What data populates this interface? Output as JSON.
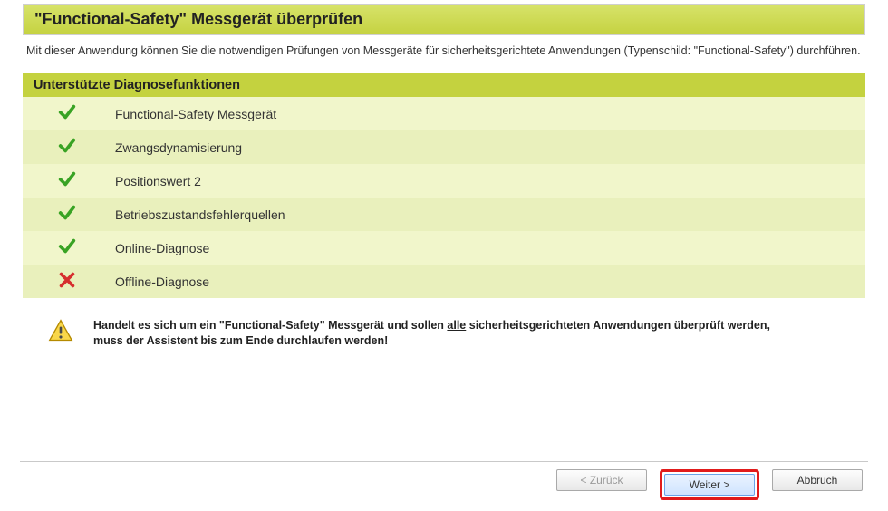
{
  "header": {
    "title": "\"Functional-Safety\" Messgerät überprüfen"
  },
  "intro": "Mit dieser Anwendung können Sie die notwendigen Prüfungen von Messgeräte für sicherheitsgerichtete Anwendungen (Typenschild: \"Functional-Safety\") durchführen.",
  "section_header": "Unterstützte Diagnosefunktionen",
  "rows": [
    {
      "status": "ok",
      "label": "Functional-Safety Messgerät"
    },
    {
      "status": "ok",
      "label": "Zwangsdynamisierung"
    },
    {
      "status": "ok",
      "label": "Positionswert 2"
    },
    {
      "status": "ok",
      "label": "Betriebszustandsfehlerquellen"
    },
    {
      "status": "ok",
      "label": "Online-Diagnose"
    },
    {
      "status": "fail",
      "label": "Offline-Diagnose"
    }
  ],
  "warning": {
    "pre": "Handelt es sich um ein \"Functional-Safety\" Messgerät und sollen ",
    "underline": "alle",
    "post": " sicherheitsgerichteten Anwendungen überprüft werden, muss der Assistent bis zum Ende durchlaufen werden!"
  },
  "buttons": {
    "back": "< Zurück",
    "next": "Weiter >",
    "cancel": "Abbruch"
  }
}
